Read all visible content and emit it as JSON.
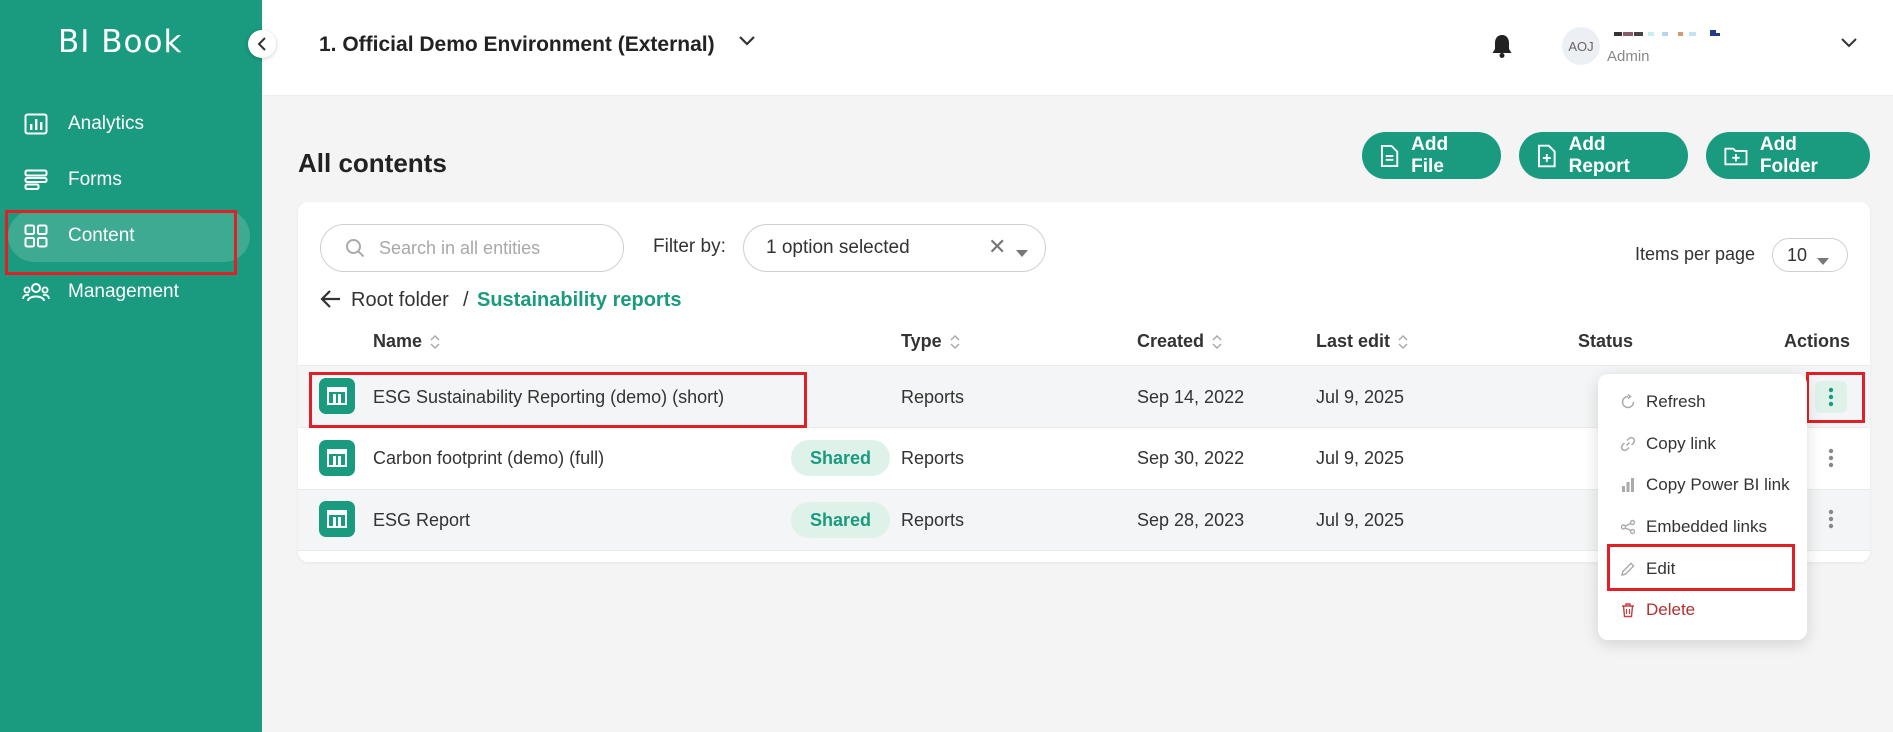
{
  "sidebar": {
    "logo": "BI Book",
    "items": [
      {
        "label": "Analytics"
      },
      {
        "label": "Forms"
      },
      {
        "label": "Content"
      },
      {
        "label": "Management"
      }
    ]
  },
  "topbar": {
    "environment": "1. Official Demo Environment (External)",
    "user": {
      "initials": "AOJ",
      "role": "Admin"
    }
  },
  "page": {
    "title": "All contents",
    "buttons": {
      "add_file": "Add File",
      "add_report": "Add Report",
      "add_folder": "Add Folder"
    }
  },
  "toolbar": {
    "search_placeholder": "Search in all entities",
    "filter_label": "Filter by:",
    "filter_value": "1 option selected",
    "items_per_page_label": "Items per page",
    "items_per_page": "10"
  },
  "breadcrumb": {
    "root": "Root folder",
    "separator": "/",
    "current": "Sustainability reports"
  },
  "table": {
    "headers": {
      "name": "Name",
      "type": "Type",
      "created": "Created",
      "last_edit": "Last edit",
      "status": "Status",
      "actions": "Actions"
    },
    "rows": [
      {
        "name": "ESG Sustainability Reporting (demo) (short)",
        "badge": "",
        "type": "Reports",
        "created": "Sep 14, 2022",
        "last_edit": "Jul 9, 2025"
      },
      {
        "name": "Carbon footprint (demo) (full)",
        "badge": "Shared",
        "type": "Reports",
        "created": "Sep 30, 2022",
        "last_edit": "Jul 9, 2025"
      },
      {
        "name": "ESG Report",
        "badge": "Shared",
        "type": "Reports",
        "created": "Sep 28, 2023",
        "last_edit": "Jul 9, 2025"
      }
    ]
  },
  "context_menu": {
    "items": [
      {
        "label": "Refresh"
      },
      {
        "label": "Copy link"
      },
      {
        "label": "Copy Power BI link"
      },
      {
        "label": "Embedded links"
      },
      {
        "label": "Edit"
      },
      {
        "label": "Delete"
      }
    ]
  },
  "colors": {
    "brand": "#1a9a7e",
    "highlight": "#e01f26",
    "danger": "#b23030"
  }
}
